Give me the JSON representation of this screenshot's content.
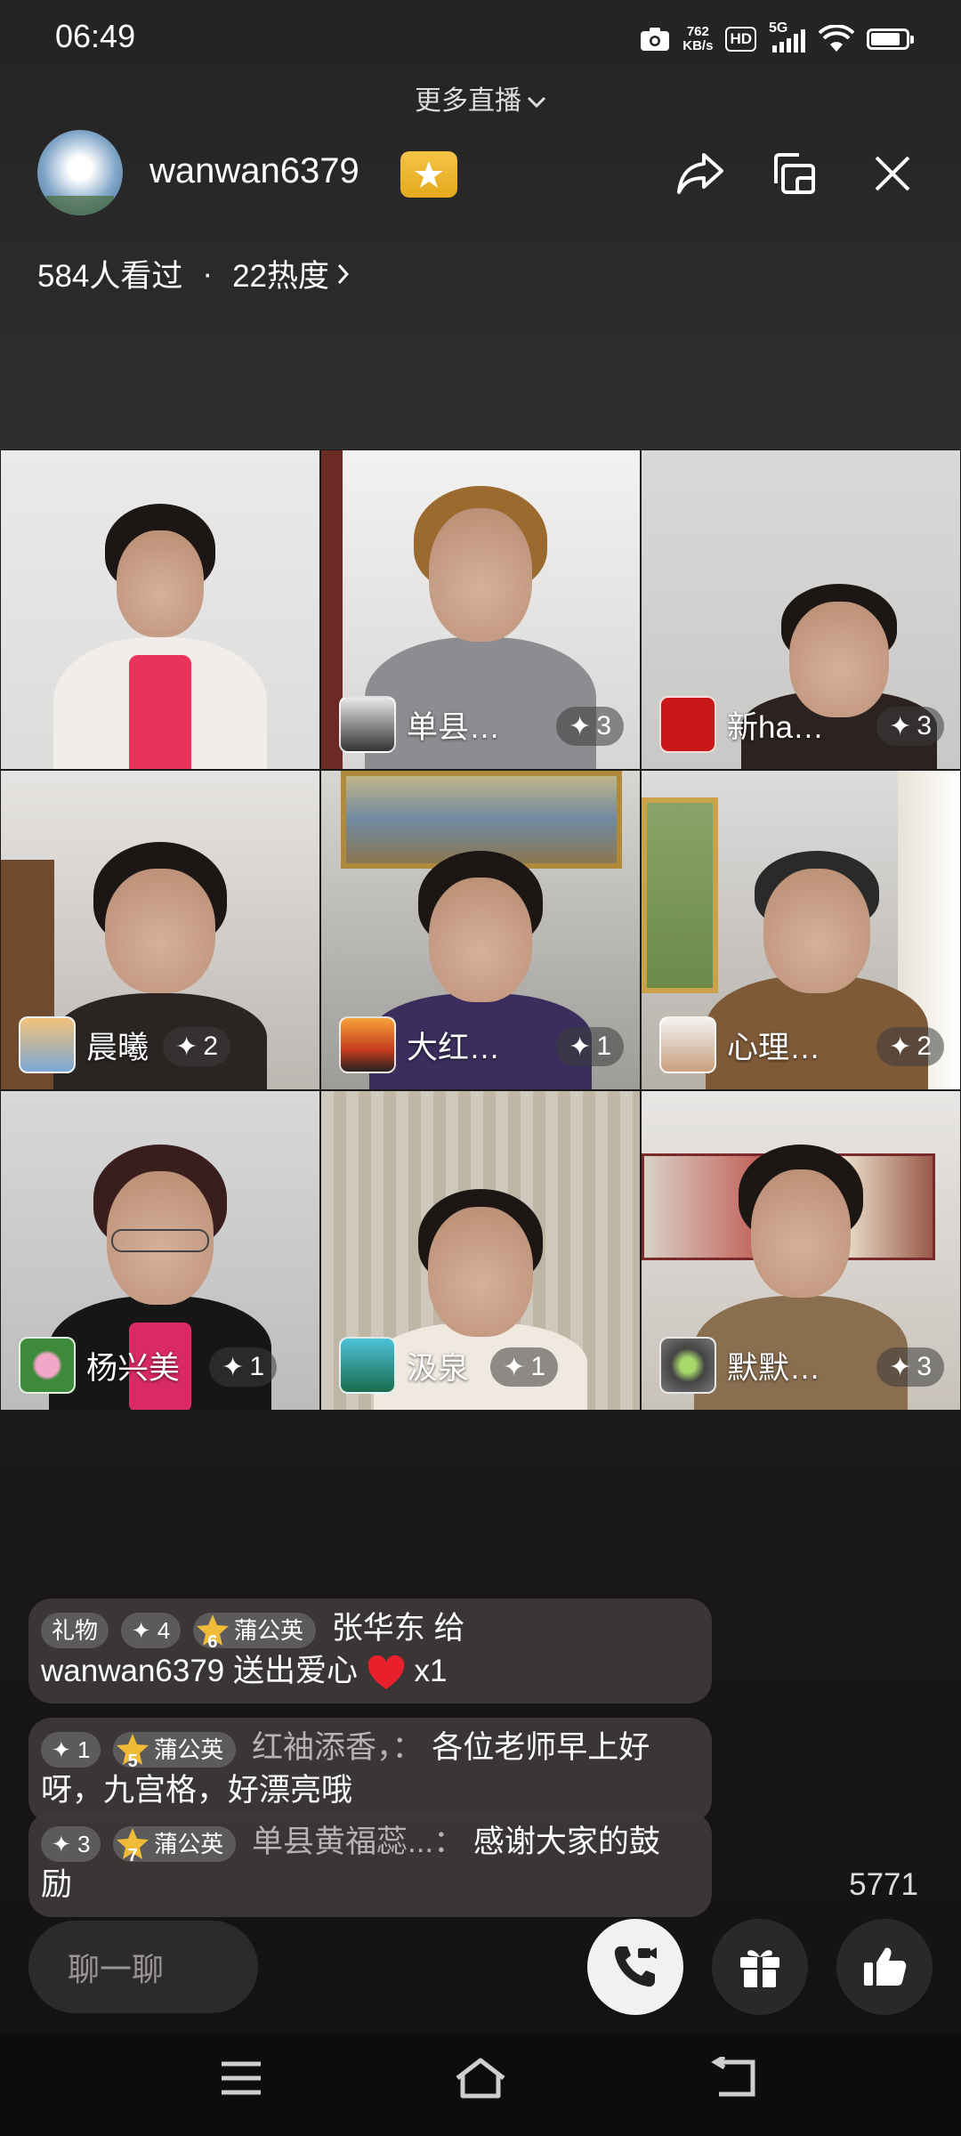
{
  "status_bar": {
    "time": "06:49",
    "net_speed_value": "762",
    "net_speed_unit": "KB/s",
    "hd": "HD",
    "network": "5G"
  },
  "header": {
    "more_live": "更多直播",
    "host_name": "wanwan6379",
    "viewers": "584人看过",
    "separator": "·",
    "heat": "22热度",
    "icons": [
      "share-icon",
      "screen-switch-icon",
      "close-icon"
    ]
  },
  "tiles": [
    {
      "name": "",
      "score": ""
    },
    {
      "name": "单县…",
      "score": "3"
    },
    {
      "name": "新ha…",
      "score": "3"
    },
    {
      "name": "晨曦",
      "score": "2"
    },
    {
      "name": "大红…",
      "score": "1"
    },
    {
      "name": "心理…",
      "score": "2"
    },
    {
      "name": "杨兴美",
      "score": "1"
    },
    {
      "name": "汲泉",
      "score": "1"
    },
    {
      "name": "默默…",
      "score": "3"
    }
  ],
  "chat": [
    {
      "gift_tag": "礼物",
      "points": "4",
      "fan_level": "6",
      "fan_club": "蒲公英",
      "user": "张华东",
      "text": "给",
      "text2": "wanwan6379 送出爱心",
      "count": "x1"
    },
    {
      "points": "1",
      "fan_level": "5",
      "fan_club": "蒲公英",
      "user": "红袖添香，",
      "colon": "：",
      "text": "各位老师早上好",
      "text2": "呀，九宫格，好漂亮哦"
    },
    {
      "points": "3",
      "fan_level": "7",
      "fan_club": "蒲公英",
      "user": "单县黄福蕊...",
      "colon": "：",
      "text": "感谢大家的鼓",
      "text2": "励"
    }
  ],
  "like_count": "5771",
  "bottom_bar": {
    "chat_placeholder": "聊一聊"
  },
  "colors": {
    "badge_gold": "#f0bc38",
    "heart_red": "#e8202c",
    "chat_bubble": "#3e3a3a"
  }
}
